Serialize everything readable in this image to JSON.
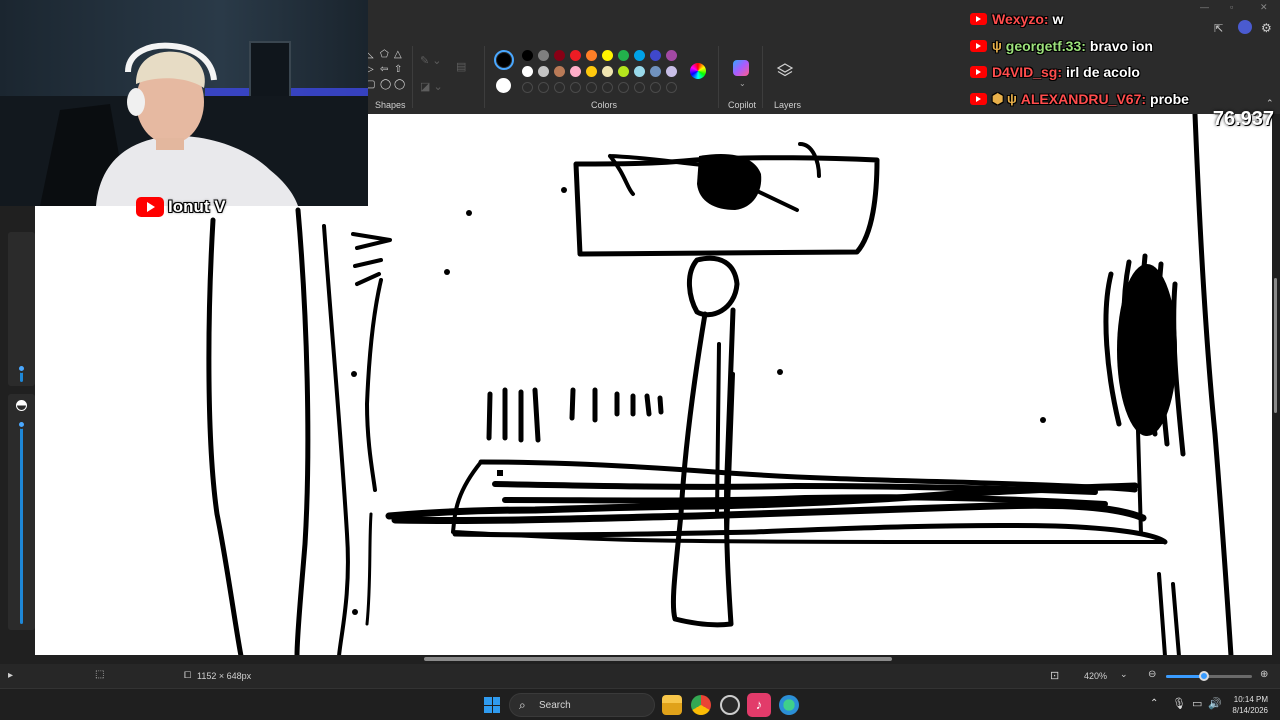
{
  "ribbon": {
    "groups": {
      "shapes": "Shapes",
      "colors": "Colors",
      "copilot": "Copilot",
      "layers": "Layers"
    },
    "active_color_primary": "#000000",
    "active_color_secondary": "#ffffff",
    "palette_row1": [
      "#000000",
      "#7f7f7f",
      "#880015",
      "#ed1c24",
      "#ff7f27",
      "#fff200",
      "#22b14c",
      "#00a2e8",
      "#3f48cc",
      "#a349a4"
    ],
    "palette_row2": [
      "#ffffff",
      "#c3c3c3",
      "#b97a57",
      "#ffaec9",
      "#ffc90e",
      "#efe4b0",
      "#b5e61d",
      "#99d9ea",
      "#7092be",
      "#c8bfe7"
    ],
    "icons": [
      "shapes-icon",
      "outline-icon",
      "fill-icon",
      "edit-colors-icon",
      "copilot-icon",
      "layers-icon"
    ]
  },
  "overlay": {
    "streamer_name": "Ionut V",
    "zoom_counter": "76.937"
  },
  "chat": [
    {
      "user": "Wexyzo:",
      "text": "w",
      "user_color": "#ff4d4d",
      "badge": ""
    },
    {
      "user": "georgetf.33:",
      "text": "bravo ion",
      "user_color": "#9be07a",
      "badge": "ψ"
    },
    {
      "user": "D4VID_sg:",
      "text": "irl de acolo",
      "user_color": "#ff4d4d",
      "badge": ""
    },
    {
      "user": "ALEXANDRU_V67:",
      "text": "probe",
      "user_color": "#ff4d4d",
      "badge": "⬢ ψ"
    }
  ],
  "statusbar": {
    "canvas_size": "1152 × 648px",
    "zoom_value": "420%"
  },
  "taskbar": {
    "search_placeholder": "Search",
    "time": "10:14 PM",
    "date": "8/14/2026"
  }
}
